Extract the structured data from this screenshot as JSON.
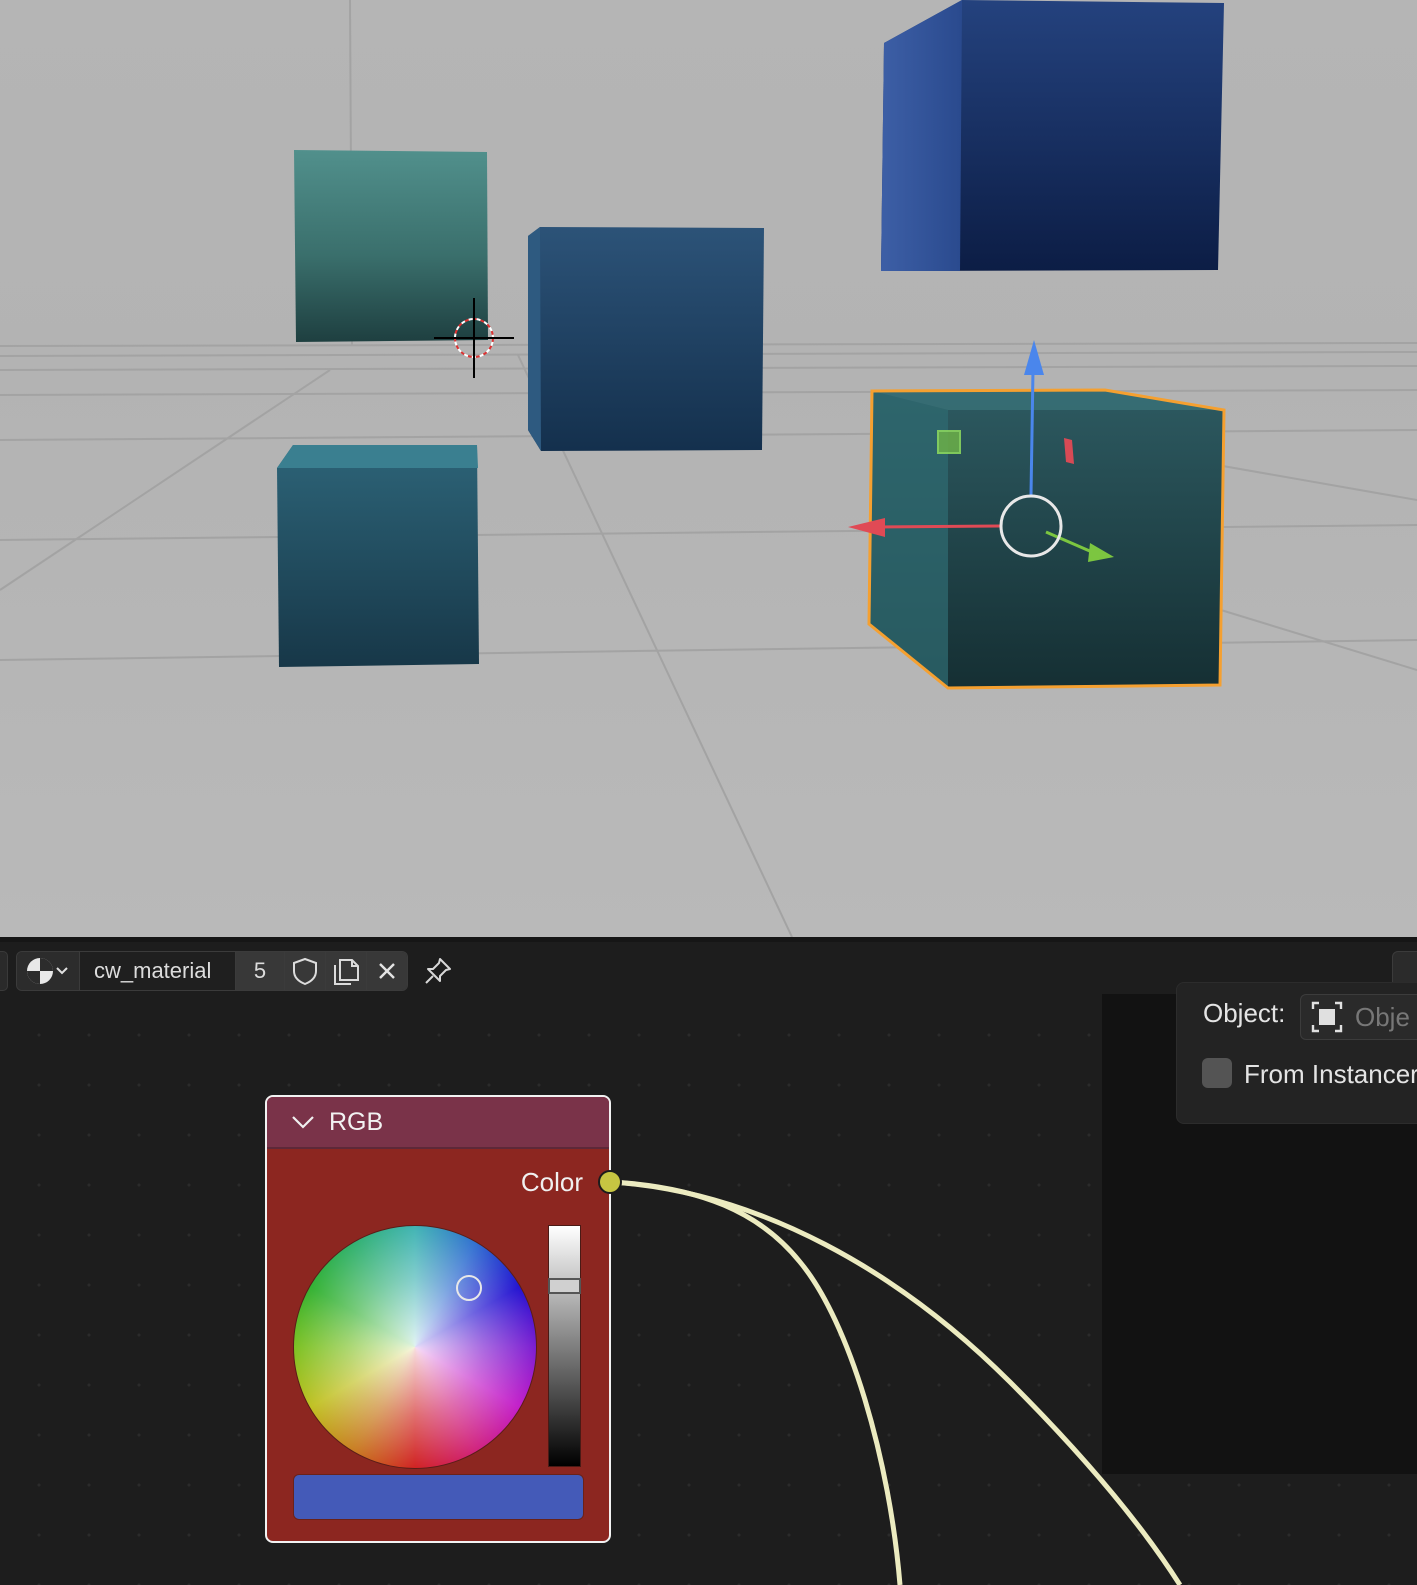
{
  "node_header": {
    "material_name": "cw_material",
    "user_count": "5"
  },
  "icons": {
    "browse": "material-sphere-icon",
    "dropdown": "chevron-down-icon",
    "fake_user": "shield-icon",
    "duplicate": "duplicate-icon",
    "unlink": "close-icon",
    "pin": "pin-icon"
  },
  "rgb_node": {
    "title": "RGB",
    "output_label": "Color",
    "swatch_color": "#445ab8"
  },
  "texture_node": {
    "object_label": "Object:",
    "object_placeholder": "Obje",
    "from_instancer_label": "From Instancer"
  },
  "colors": {
    "selection_outline": "#f5a030",
    "rgb_node_body": "#8c2620",
    "rgb_node_header": "#7a3349",
    "socket_color": "#c7c542",
    "wire_color": "#ecebc0"
  }
}
